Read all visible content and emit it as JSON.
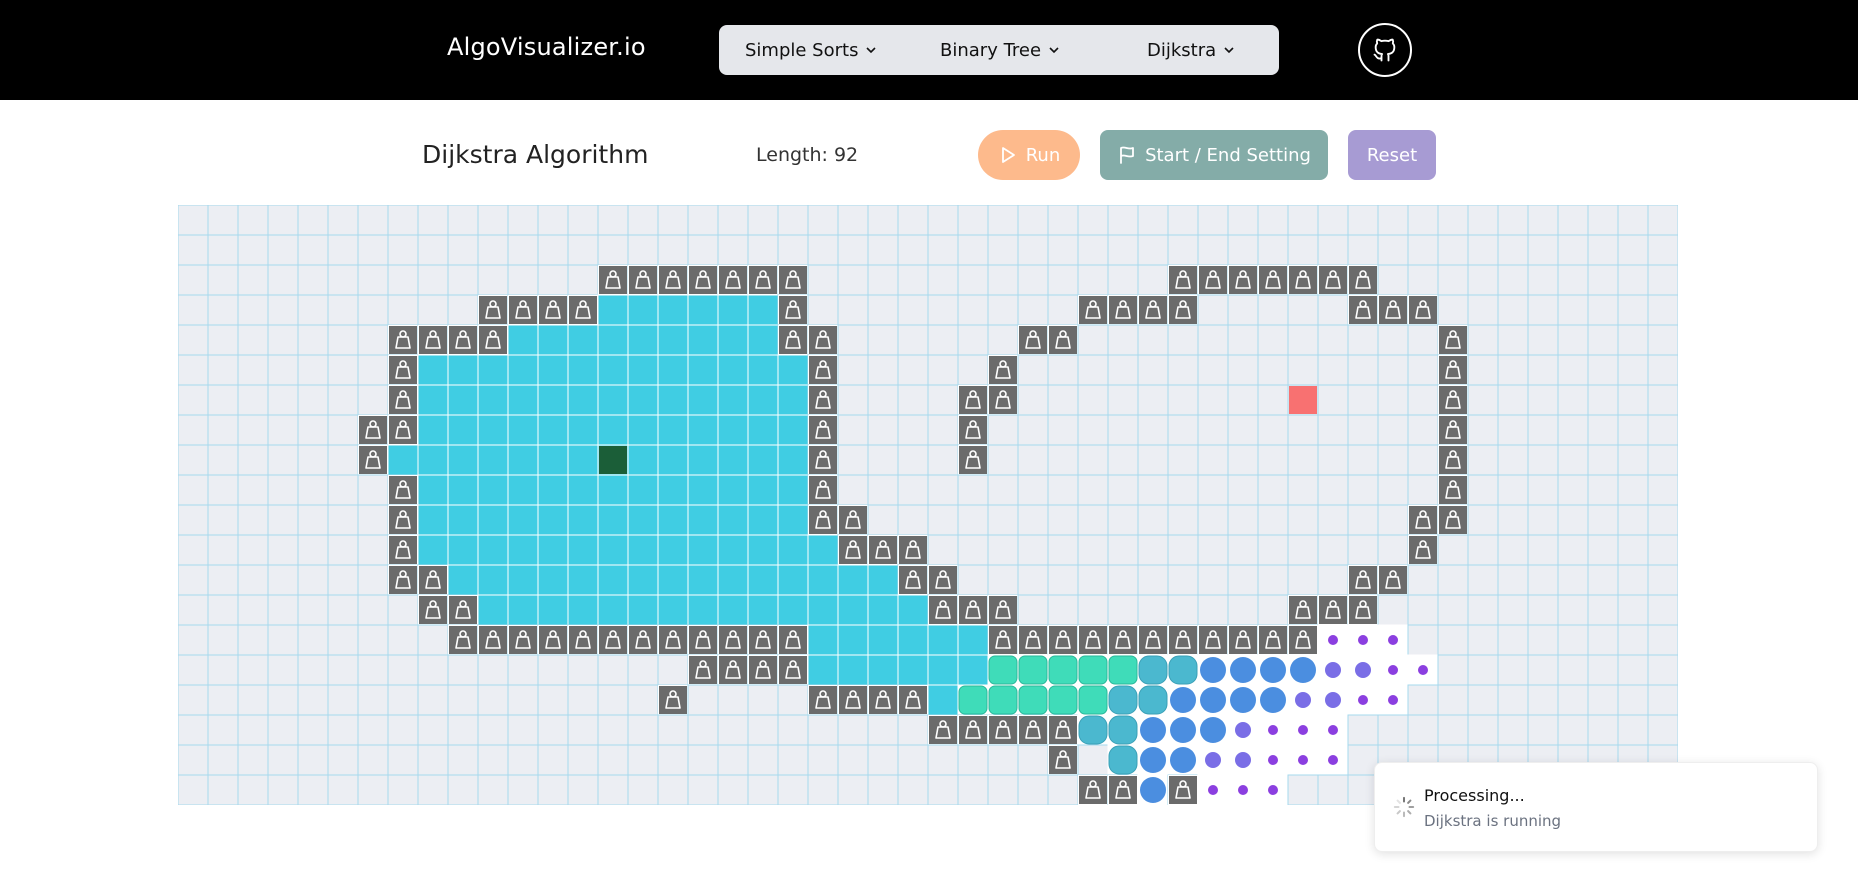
{
  "brand": "AlgoVisualizer.io",
  "nav": {
    "items": [
      {
        "label": "Simple Sorts"
      },
      {
        "label": "Binary Tree"
      },
      {
        "label": "Dijkstra"
      }
    ]
  },
  "header": {
    "title": "Dijkstra Algorithm",
    "length_label": "Length:",
    "length_value": "92"
  },
  "buttons": {
    "run": "Run",
    "start_end": "Start / End Setting",
    "reset": "Reset"
  },
  "toast": {
    "title": "Processing...",
    "subtitle": "Dijkstra is running"
  },
  "colors": {
    "visited": "#40cde3",
    "start": "#1b5e38",
    "end": "#f87171",
    "wall": "#6b6b6b",
    "cell": "#eceef3",
    "gridline": "#a6d9ee"
  },
  "grid": {
    "cols": 50,
    "rows": 20,
    "start": [
      8,
      14
    ],
    "end": [
      6,
      37
    ],
    "walls_by_row": {
      "2": [
        [
          14,
          20
        ]
      ],
      "3": [
        [
          10,
          13
        ],
        [
          20,
          20
        ]
      ],
      "4": [
        [
          7,
          10
        ],
        [
          20,
          21
        ]
      ],
      "5": [
        [
          7,
          7
        ],
        [
          21,
          21
        ]
      ],
      "6": [
        [
          7,
          7
        ],
        [
          21,
          21
        ]
      ],
      "7": [
        [
          6,
          7
        ],
        [
          21,
          21
        ]
      ],
      "8": [
        [
          6,
          6
        ],
        [
          21,
          21
        ]
      ],
      "9": [
        [
          7,
          7
        ],
        [
          21,
          21
        ]
      ],
      "10": [
        [
          7,
          7
        ],
        [
          21,
          22
        ]
      ],
      "11": [
        [
          7,
          7
        ],
        [
          22,
          24
        ]
      ],
      "12": [
        [
          7,
          8
        ],
        [
          24,
          25
        ]
      ],
      "13": [
        [
          8,
          9
        ],
        [
          25,
          27
        ]
      ],
      "14": [
        [
          9,
          20
        ]
      ],
      "15": [
        [
          17,
          20
        ]
      ],
      "16": [
        [
          16,
          16
        ],
        [
          21,
          24
        ]
      ],
      "17": [
        [
          25,
          29
        ]
      ],
      "18": [
        [
          29,
          29
        ]
      ],
      "19": [
        [
          30,
          31
        ],
        [
          33,
          33
        ]
      ]
    },
    "walls_right": {
      "2": [
        [
          33,
          39
        ]
      ],
      "3": [
        [
          30,
          33
        ],
        [
          39,
          41
        ]
      ],
      "4": [
        [
          28,
          29
        ],
        [
          42,
          42
        ]
      ],
      "5": [
        [
          27,
          27
        ],
        [
          42,
          42
        ]
      ],
      "6": [
        [
          26,
          27
        ],
        [
          42,
          42
        ]
      ],
      "7": [
        [
          26,
          26
        ],
        [
          42,
          42
        ]
      ],
      "8": [
        [
          26,
          26
        ],
        [
          42,
          42
        ]
      ],
      "9": [
        [
          42,
          42
        ]
      ],
      "10": [
        [
          41,
          42
        ]
      ],
      "11": [
        [
          41,
          41
        ]
      ],
      "12": [
        [
          39,
          40
        ]
      ],
      "13": [
        [
          37,
          39
        ]
      ],
      "14": [
        [
          27,
          37
        ]
      ]
    },
    "visited_by_row": {
      "3": [
        [
          14,
          19
        ]
      ],
      "4": [
        [
          11,
          19
        ]
      ],
      "5": [
        [
          8,
          20
        ]
      ],
      "6": [
        [
          8,
          20
        ]
      ],
      "7": [
        [
          8,
          20
        ]
      ],
      "8": [
        [
          7,
          20
        ]
      ],
      "9": [
        [
          8,
          20
        ]
      ],
      "10": [
        [
          8,
          20
        ]
      ],
      "11": [
        [
          8,
          21
        ]
      ],
      "12": [
        [
          9,
          23
        ]
      ],
      "13": [
        [
          10,
          24
        ]
      ],
      "14": [
        [
          21,
          26
        ]
      ],
      "15": [
        [
          21,
          26
        ]
      ],
      "16": [
        [
          25,
          26
        ]
      ]
    },
    "frontier": {
      "15": [
        [
          27,
          31,
          "teal"
        ],
        [
          32,
          33,
          "tealblue"
        ],
        [
          34,
          35,
          "blue"
        ],
        [
          36,
          37,
          "blue"
        ],
        [
          38,
          39,
          "violet-dot"
        ],
        [
          40,
          41,
          "purple-dot"
        ]
      ],
      "16": [
        [
          26,
          30,
          "teal"
        ],
        [
          31,
          32,
          "tealblue"
        ],
        [
          33,
          34,
          "blue"
        ],
        [
          35,
          36,
          "blue"
        ],
        [
          37,
          38,
          "violet-dot"
        ],
        [
          39,
          40,
          "purple-dot"
        ]
      ],
      "17": [
        [
          30,
          31,
          "tealblue"
        ],
        [
          32,
          33,
          "blue"
        ],
        [
          34,
          34,
          "blue"
        ],
        [
          35,
          35,
          "violet-dot"
        ],
        [
          36,
          38,
          "purple-dot"
        ]
      ],
      "18": [
        [
          31,
          31,
          "tealblue"
        ],
        [
          32,
          33,
          "blue"
        ],
        [
          34,
          35,
          "violet-dot"
        ],
        [
          36,
          38,
          "purple-dot"
        ]
      ],
      "19": [
        [
          32,
          32,
          "blue"
        ],
        [
          34,
          36,
          "purple-dot"
        ]
      ],
      "14": [
        [
          38,
          40,
          "purple-dot"
        ]
      ]
    }
  }
}
